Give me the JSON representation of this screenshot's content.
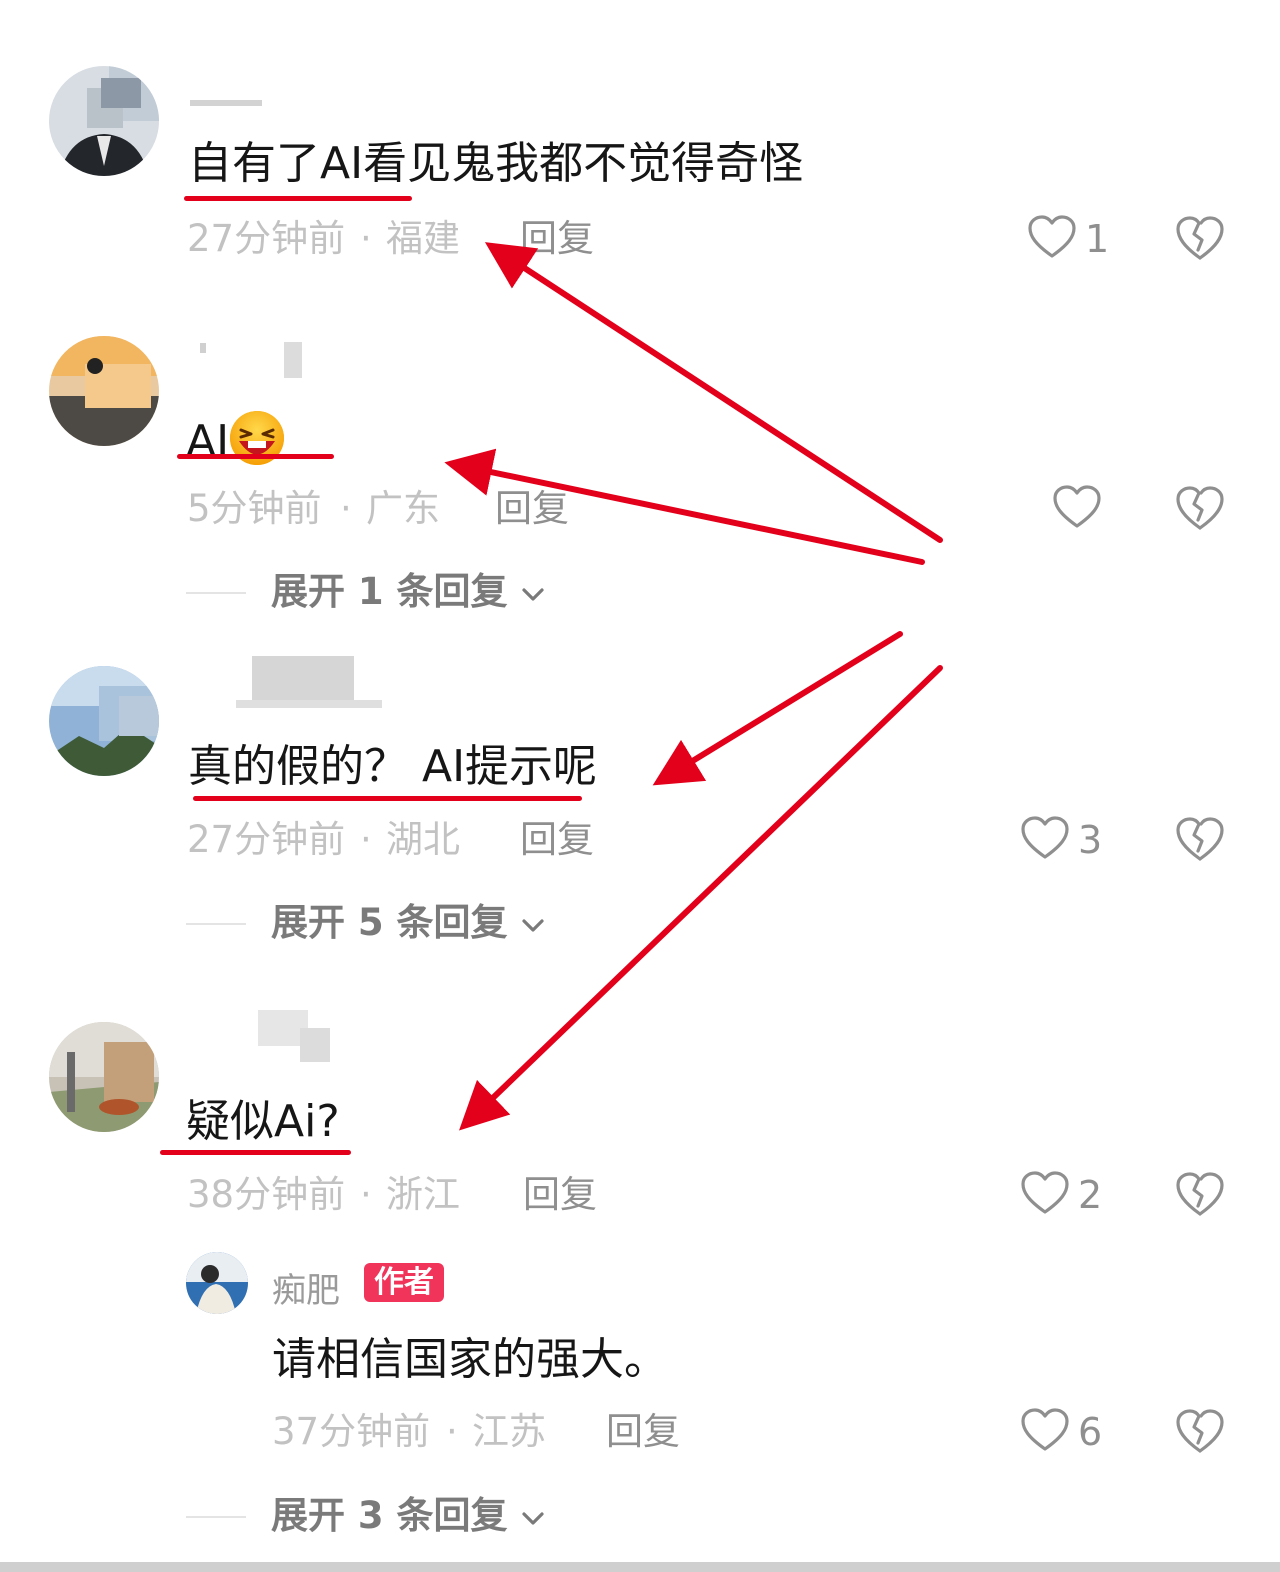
{
  "comments": [
    {
      "body": "自有了AI看见鬼我都不觉得奇怪",
      "time": "27分钟前",
      "sep": "·",
      "region": "福建",
      "reply": "回复",
      "likes": "1"
    },
    {
      "body_text": "AI",
      "body_emoji": "laughing-face-emoji",
      "time": "5分钟前",
      "sep": "·",
      "region": "广东",
      "reply": "回复",
      "likes": "",
      "expand": "展开 1 条回复"
    },
    {
      "body": "真的假的？ AI提示呢",
      "time": "27分钟前",
      "sep": "·",
      "region": "湖北",
      "reply": "回复",
      "likes": "3",
      "expand": "展开 5 条回复"
    },
    {
      "body": "疑似Ai?",
      "time": "38分钟前",
      "sep": "·",
      "region": "浙江",
      "reply": "回复",
      "likes": "2"
    }
  ],
  "author_reply": {
    "username": "痴肥",
    "badge": "作者",
    "body": "请相信国家的强大。",
    "time": "37分钟前",
    "sep": "·",
    "region": "江苏",
    "reply": "回复",
    "likes": "6",
    "expand": "展开 3 条回复"
  },
  "usernames_partial": [
    "",
    "",
    "",
    ""
  ],
  "icons": {
    "like": "heart-outline-icon",
    "dislike": "broken-heart-icon",
    "expand": "chevron-down-icon"
  },
  "colors": {
    "annotation_red": "#e3001b",
    "author_badge": "#f0345a",
    "meta_gray": "#c2c2c2",
    "reply_gray": "#8f8f8f"
  }
}
